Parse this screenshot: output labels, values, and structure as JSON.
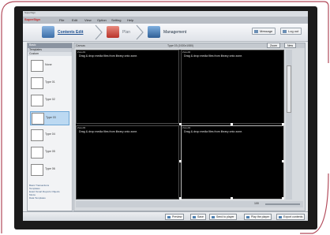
{
  "window": {
    "title": "SuperSign"
  },
  "menubar": {
    "brand": "SuperSign",
    "items": [
      "File",
      "Edit",
      "View",
      "Option",
      "Setting",
      "Help"
    ]
  },
  "toolbar": {
    "steps": [
      {
        "label": "Contents Edit",
        "icon": "contents-edit-icon"
      },
      {
        "label": "Plan",
        "icon": "plan-icon"
      },
      {
        "label": "Management",
        "icon": "management-icon"
      }
    ],
    "message_label": "Message",
    "logout_label": "Log out"
  },
  "left_panel": {
    "header": "Basic",
    "section": "Templates",
    "sub": "Custom",
    "templates": [
      "None",
      "Type 01",
      "Type 02",
      "Type 03",
      "Type 04",
      "Type 05",
      "Type 06"
    ],
    "selected_index": 3,
    "links": [
      "Basic Transactions",
      "Templates",
      "Exact Smart Reports Objects",
      "Movie",
      "Data Templates"
    ]
  },
  "work": {
    "left_label": "Canvas",
    "title": "Type 03 (1920x1080)",
    "zoom_label": "Zoom",
    "new_label": "New",
    "zoom_value": "100",
    "zones": [
      {
        "name": "Zone01",
        "message": "Drag & drop media files from library onto zone."
      },
      {
        "name": "Zone02",
        "message": "Drag & drop media files from library onto zone."
      },
      {
        "name": "Zone03",
        "message": "Drag & drop media files from library onto zone."
      },
      {
        "name": "Zone04",
        "message": "Drag & drop media files from library onto zone."
      }
    ]
  },
  "bottom": {
    "buttons": [
      "Preview",
      "Save",
      "Send to player",
      "Play the player",
      "Export contents"
    ]
  }
}
